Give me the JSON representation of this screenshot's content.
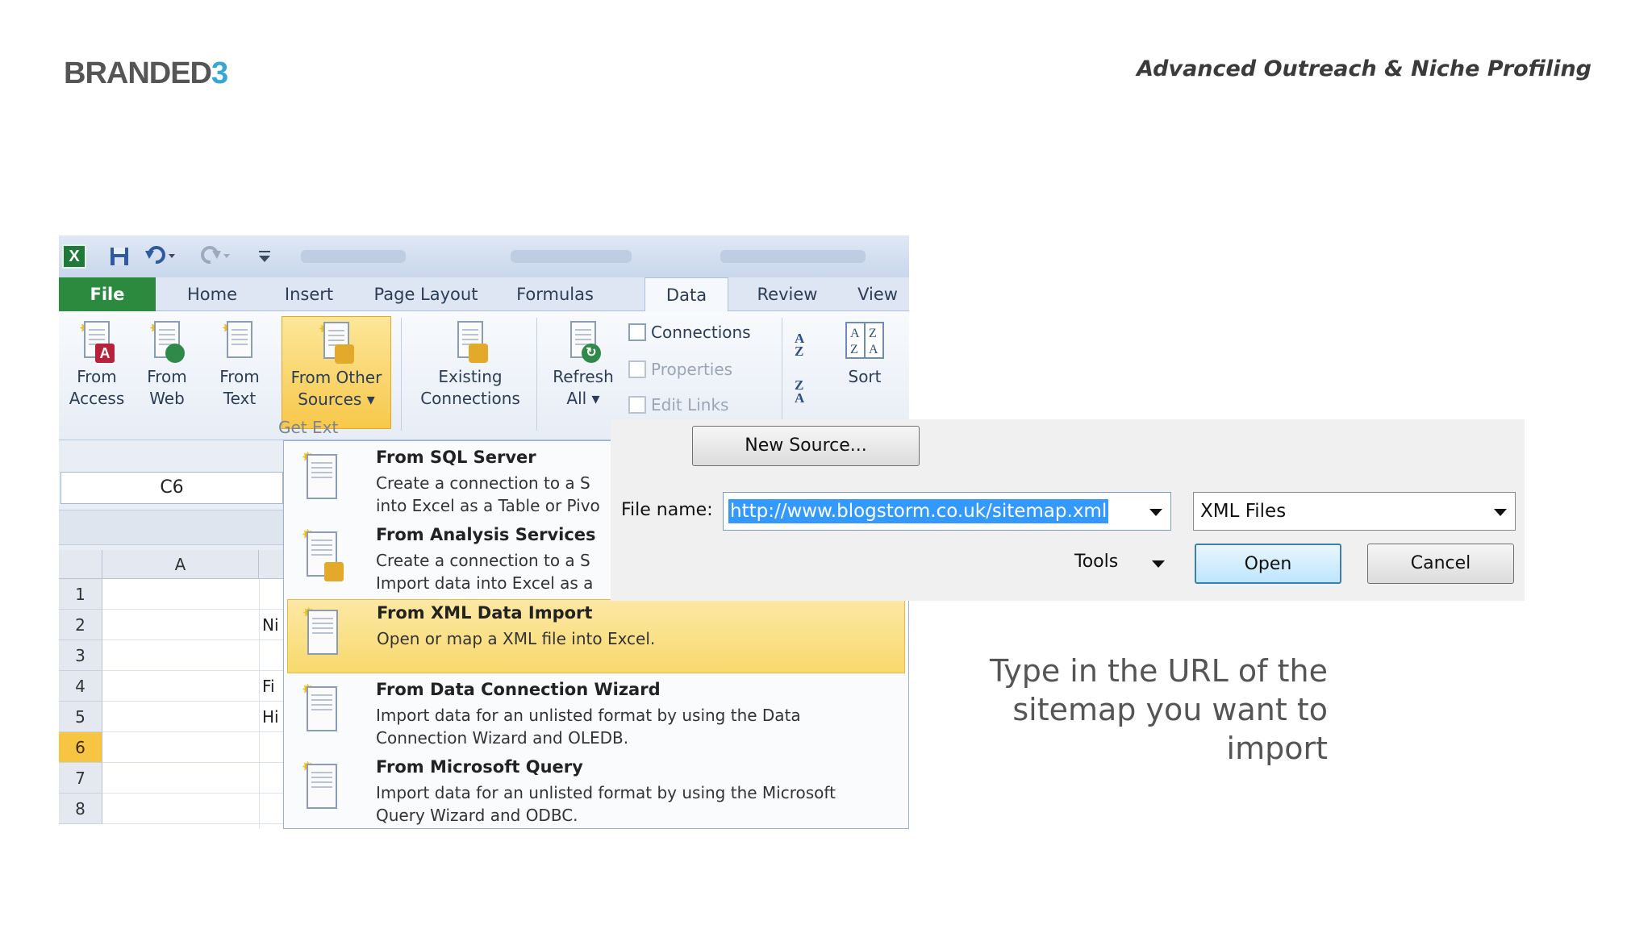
{
  "header": {
    "brand_main": "BRANDED",
    "brand_num": "3",
    "title": "Advanced Outreach & Niche Profiling"
  },
  "excel": {
    "qat": {
      "icons": [
        "excel-icon",
        "save-icon",
        "undo-icon",
        "redo-icon",
        "customize-qat-icon"
      ]
    },
    "tabs": [
      "File",
      "Home",
      "Insert",
      "Page Layout",
      "Formulas",
      "Data",
      "Review",
      "View"
    ],
    "active_tab": "Data",
    "ribbon": {
      "from_access": [
        "From",
        "Access"
      ],
      "from_web": [
        "From",
        "Web"
      ],
      "from_text": [
        "From",
        "Text"
      ],
      "from_other": [
        "From Other",
        "Sources ▾"
      ],
      "existing": [
        "Existing",
        "Connections"
      ],
      "refresh": [
        "Refresh",
        "All ▾"
      ],
      "connections": "Connections",
      "properties": "Properties",
      "edit_links": "Edit Links",
      "sort": "Sort",
      "group_label": "Get Ext"
    },
    "namebox": "C6",
    "column_a": "A",
    "rows": [
      "1",
      "2",
      "3",
      "4",
      "5",
      "6",
      "7",
      "8"
    ],
    "selected_row": "6",
    "col_b_fragments": {
      "r2": "Ni",
      "r4": "Fi",
      "r5": "Hi"
    }
  },
  "menu": {
    "items": [
      {
        "title": "From SQL Server",
        "desc1": "Create a connection to a S",
        "desc2": "into Excel as a Table or Pivo"
      },
      {
        "title": "From Analysis Services",
        "desc1": "Create a connection to a S",
        "desc2": "Import data into Excel as a"
      },
      {
        "title": "From XML Data Import",
        "desc1": "Open or map a XML file into Excel.",
        "desc2": ""
      },
      {
        "title": "From Data Connection Wizard",
        "desc1": "Import data for an unlisted format by using the Data",
        "desc2": "Connection Wizard and OLEDB."
      },
      {
        "title": "From Microsoft Query",
        "desc1": "Import data for an unlisted format by using the Microsoft",
        "desc2": "Query Wizard and ODBC."
      }
    ]
  },
  "dialog": {
    "new_source": "New Source...",
    "file_name_label": "File name:",
    "file_name_value": "http://www.blogstorm.co.uk/sitemap.xml",
    "file_type": "XML Files",
    "tools": "Tools",
    "open": "Open",
    "cancel": "Cancel"
  },
  "caption": {
    "line1": "Type in the URL of the",
    "line2": "sitemap you want to",
    "line3": "import"
  }
}
